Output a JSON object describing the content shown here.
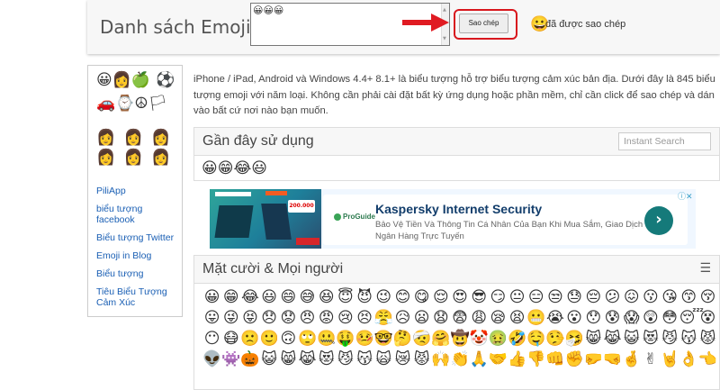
{
  "header": {
    "title": "Danh sách Emoji",
    "picked_value": "😀😀😀",
    "copy_label": "Sao chép",
    "copied_status": "đã được sao chép",
    "copied_face": "😀"
  },
  "sidebar": {
    "category_rows": [
      [
        "😀",
        "👩",
        "🍏"
      ],
      [
        "⚽",
        "🚗",
        "⌚",
        "☮",
        "🏳"
      ]
    ],
    "skin_tones": [
      [
        "👩",
        "👩",
        "👩"
      ],
      [
        "👩",
        "👩",
        "👩"
      ]
    ],
    "links": [
      "PiliApp",
      "biểu tượng facebook",
      "Biểu tượng Twitter",
      "Emoji in Blog",
      "Biểu tượng",
      "Tiêu Biểu Tượng Cảm Xúc"
    ]
  },
  "intro": "iPhone / iPad, Android và Windows 4.4+ 8.1+ là biểu tượng hỗ trợ biểu tượng cảm xúc bản địa. Dưới đây là 845 biểu tượng emoji với năm loại. Không cần phải cài đặt bất kỳ ứng dụng hoặc phần mềm, chỉ cần click để sao chép và dán vào bất cứ nơi nào bạn muốn.",
  "recent": {
    "title": "Gần đây sử dụng",
    "search_placeholder": "Instant Search",
    "emojis": "😀😁😂😃"
  },
  "ad": {
    "brand": "ProGuide",
    "title": "Kaspersky Internet Security",
    "description": "Bảo Vệ Tiền Và Thông Tin Cá Nhân Của Bạn Khi Mua Sắm, Giao Dịch Ngân Hàng Trực Tuyến",
    "go_symbol": "›",
    "choices_symbol": "ⓘ✕",
    "image_price": "200.000",
    "image_buy": "MUA NGAY"
  },
  "smileys": {
    "title": "Mặt cười & Mọi người",
    "menu_icon": "☰",
    "rows": [
      [
        "😀",
        "😁",
        "😂",
        "😃",
        "😄",
        "😅",
        "😆",
        "😇",
        "😈",
        "😉",
        "😊",
        "😋",
        "😌",
        "😍",
        "😎",
        "😏",
        "😐",
        "😑",
        "😒",
        "😓",
        "😔",
        "😕",
        "😖",
        "😗",
        "😘",
        "😙",
        "😚"
      ],
      [
        "😛",
        "😜",
        "😝",
        "😞",
        "😟",
        "😠",
        "😡",
        "😢",
        "😣",
        "😤",
        "😥",
        "😦",
        "😧",
        "😨",
        "😩",
        "😪",
        "😫",
        "😬",
        "😭",
        "😮",
        "😯",
        "😰",
        "😱",
        "😲",
        "😳",
        "😴",
        "😵"
      ],
      [
        "😶",
        "😷",
        "🙁",
        "🙂",
        "🙃",
        "🙄",
        "🤐",
        "🤑",
        "🤒",
        "🤓",
        "🤔",
        "🤕",
        "🤗",
        "🤠",
        "🤡",
        "🤢",
        "🤣",
        "🤤",
        "🤥",
        "🤧",
        "😸",
        "😹",
        "😺",
        "😻",
        "😼",
        "😽",
        "😾"
      ],
      [
        "👽",
        "👾",
        "🎃",
        "😺",
        "😸",
        "😹",
        "😻",
        "😼",
        "😽",
        "🙀",
        "😿",
        "😾",
        "🙌",
        "👏",
        "🙏",
        "🤝",
        "👍",
        "👎",
        "👊",
        "✊",
        "🤛",
        "🤜",
        "🤞",
        "✌",
        "🤘",
        "👌",
        "👈"
      ]
    ]
  }
}
